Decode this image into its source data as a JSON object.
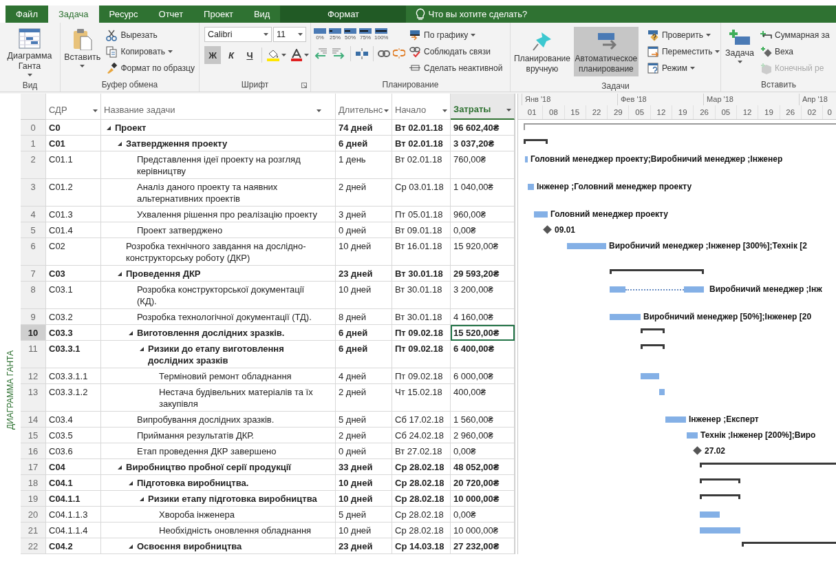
{
  "tabs": [
    {
      "label": "Файл",
      "selected": false
    },
    {
      "label": "Задача",
      "selected": true
    },
    {
      "label": "Ресурс",
      "selected": false
    },
    {
      "label": "Отчет",
      "selected": false
    },
    {
      "label": "Проект",
      "selected": false
    },
    {
      "label": "Вид",
      "selected": false
    }
  ],
  "context_tab": {
    "label": "Формат",
    "selected": false
  },
  "tell_me": {
    "placeholder": "Что вы хотите сделать?"
  },
  "ribbon": {
    "view": {
      "label": "Вид",
      "gantt_button": {
        "label": "Диаграмма Ганта",
        "dropdown": true
      }
    },
    "clipboard": {
      "label": "Буфер обмена",
      "paste": {
        "label": "Вставить",
        "dropdown": true
      },
      "items": [
        {
          "label": "Вырезать",
          "dropdown": false
        },
        {
          "label": "Копировать",
          "dropdown": true
        },
        {
          "label": "Формат по образцу",
          "dropdown": false
        }
      ]
    },
    "font": {
      "label": "Шрифт",
      "font_name": "Calibri",
      "font_size": "11",
      "styles": [
        {
          "label": "Ж",
          "on": true
        },
        {
          "label": "К",
          "on": false
        },
        {
          "label": "Ч",
          "on": false
        }
      ]
    },
    "schedule": {
      "label": "Планирование",
      "percent": [
        "0%",
        "25%",
        "50%",
        "75%",
        "100%"
      ],
      "items": [
        {
          "label": "По графику",
          "dropdown": true
        },
        {
          "label": "Соблюдать связи",
          "dropdown": false
        },
        {
          "label": "Сделать неактивной",
          "dropdown": false
        }
      ]
    },
    "tasks": {
      "label": "Задачи",
      "modes": [
        {
          "label": "Планирование вручную",
          "selected": false
        },
        {
          "label": "Автоматическое планирование",
          "selected": true
        }
      ],
      "items": [
        {
          "label": "Проверить",
          "dropdown": true
        },
        {
          "label": "Переместить",
          "dropdown": true
        },
        {
          "label": "Режим",
          "dropdown": true
        }
      ]
    },
    "insert": {
      "label": "Вставить",
      "task": {
        "label": "Задача",
        "dropdown": true
      },
      "items": [
        {
          "label": "Суммарная за",
          "disabled": false
        },
        {
          "label": "Веха",
          "disabled": false
        },
        {
          "label": "Конечный ре",
          "disabled": true
        }
      ]
    }
  },
  "view_label": "ДИАГРАММА ГАНТА",
  "columns": [
    {
      "label": "СДР",
      "selected": false
    },
    {
      "label": "Название задачи",
      "selected": false
    },
    {
      "label": "Длительнс",
      "selected": false
    },
    {
      "label": "Начало",
      "selected": false
    },
    {
      "label": "Затраты",
      "selected": true
    }
  ],
  "timeline": {
    "months": [
      "Янв '18",
      "Фев '18",
      "Мар '18",
      "Апр '18"
    ],
    "weeks": [
      "01",
      "08",
      "15",
      "22",
      "29",
      "05",
      "12",
      "19",
      "26",
      "05",
      "12",
      "19",
      "26",
      "02",
      "0"
    ]
  },
  "tasks": [
    {
      "id": "0",
      "wbs": "C0",
      "name": "Проект",
      "duration": "74 дней",
      "start": "Вт 02.01.18",
      "cost": "96 602,40₴",
      "kind": "project",
      "expanded": true,
      "selected": false,
      "children": [
        {
          "id": "1",
          "wbs": "C01",
          "name": "Затвердження проекту",
          "duration": "6 дней",
          "start": "Вт 02.01.18",
          "cost": "3 037,20₴",
          "kind": "summary",
          "expanded": true,
          "selected": false,
          "children": [
            {
              "id": "2",
              "wbs": "C01.1",
              "name": "Представлення ідеї проекту на розгляд керівництву",
              "duration": "1 день",
              "start": "Вт 02.01.18",
              "cost": "760,00₴",
              "kind": "task",
              "selected": false,
              "bar_label": "Головний менеджер проекту;Виробничий менеджер ;Інженер"
            },
            {
              "id": "3",
              "wbs": "C01.2",
              "name": "Аналіз даного проекту та наявних альтернативних проектів",
              "duration": "2 дней",
              "start": "Ср 03.01.18",
              "cost": "1 040,00₴",
              "kind": "task",
              "selected": false,
              "bar_label": "Інженер ;Головний менеджер проекту"
            },
            {
              "id": "4",
              "wbs": "C01.3",
              "name": "Ухвалення рішення про реалізацію проекту",
              "duration": "3 дней",
              "start": "Пт 05.01.18",
              "cost": "960,00₴",
              "kind": "task",
              "selected": false,
              "bar_label": "Головний менеджер проекту"
            },
            {
              "id": "5",
              "wbs": "C01.4",
              "name": "Проект затверджено",
              "duration": "0 дней",
              "start": "Вт 09.01.18",
              "cost": "0,00₴",
              "kind": "milestone",
              "selected": false,
              "bar_label": "09.01"
            }
          ]
        },
        {
          "id": "6",
          "wbs": "C02",
          "name": "Розробка технічного завдання на дослідно-конструкторську роботу (ДКР)",
          "duration": "10 дней",
          "start": "Вт 16.01.18",
          "cost": "15 920,00₴",
          "kind": "task",
          "selected": false,
          "bar_label": "Виробничий менеджер ;Інженер [300%];Технік [2"
        },
        {
          "id": "7",
          "wbs": "C03",
          "name": "Проведення ДКР",
          "duration": "23 дней",
          "start": "Вт 30.01.18",
          "cost": "29 593,20₴",
          "kind": "summary",
          "expanded": true,
          "selected": false,
          "children": [
            {
              "id": "8",
              "wbs": "C03.1",
              "name": "Розробка конструкторської документації (КД).",
              "duration": "10 дней",
              "start": "Вт 30.01.18",
              "cost": "3 200,00₴",
              "kind": "split",
              "selected": false,
              "bar_label": "Виробничий менеджер ;Інж"
            },
            {
              "id": "9",
              "wbs": "C03.2",
              "name": "Розробка технологічної документації (ТД).",
              "duration": "8 дней",
              "start": "Вт 30.01.18",
              "cost": "4 160,00₴",
              "kind": "task",
              "selected": false,
              "bar_label": "Виробничий менеджер [50%];Інженер [20"
            },
            {
              "id": "10",
              "wbs": "C03.3",
              "name": "Виготовлення дослідних зразків.",
              "duration": "6 дней",
              "start": "Пт 09.02.18",
              "cost": "15 520,00₴",
              "kind": "summary",
              "expanded": true,
              "selected": true,
              "children": [
                {
                  "id": "11",
                  "wbs": "C03.3.1",
                  "name": "Ризики до етапу виготовлення дослідних зразків",
                  "duration": "6 дней",
                  "start": "Пт 09.02.18",
                  "cost": "6 400,00₴",
                  "kind": "summary",
                  "expanded": true,
                  "selected": false,
                  "children": [
                    {
                      "id": "12",
                      "wbs": "C03.3.1.1",
                      "name": "Терміновий ремонт обладнання",
                      "duration": "4 дней",
                      "start": "Пт 09.02.18",
                      "cost": "6 000,00₴",
                      "kind": "task",
                      "selected": false
                    },
                    {
                      "id": "13",
                      "wbs": "C03.3.1.2",
                      "name": "Нестача будівельних матеріалів та їх закупівля",
                      "duration": "2 дней",
                      "start": "Чт 15.02.18",
                      "cost": "400,00₴",
                      "kind": "task",
                      "selected": false
                    }
                  ]
                }
              ]
            },
            {
              "id": "14",
              "wbs": "C03.4",
              "name": "Випробування дослідних зразків.",
              "duration": "5 дней",
              "start": "Сб 17.02.18",
              "cost": "1 560,00₴",
              "kind": "task",
              "selected": false,
              "bar_label": "Інженер ;Експерт"
            },
            {
              "id": "15",
              "wbs": "C03.5",
              "name": "Приймання результатів ДКР.",
              "duration": "2 дней",
              "start": "Сб 24.02.18",
              "cost": "2 960,00₴",
              "kind": "task",
              "selected": false,
              "bar_label": "Технік ;Інженер [200%];Виро"
            },
            {
              "id": "16",
              "wbs": "C03.6",
              "name": "Етап проведення ДКР завершено",
              "duration": "0 дней",
              "start": "Вт 27.02.18",
              "cost": "0,00₴",
              "kind": "milestone",
              "selected": false,
              "bar_label": "27.02"
            }
          ]
        },
        {
          "id": "17",
          "wbs": "C04",
          "name": "Виробництво пробної серії продукції",
          "duration": "33 дней",
          "start": "Ср 28.02.18",
          "cost": "48 052,00₴",
          "kind": "summary",
          "expanded": true,
          "selected": false,
          "children": [
            {
              "id": "18",
              "wbs": "C04.1",
              "name": "Підготовка виробництва.",
              "duration": "10 дней",
              "start": "Ср 28.02.18",
              "cost": "20 720,00₴",
              "kind": "summary",
              "expanded": true,
              "selected": false,
              "children": [
                {
                  "id": "19",
                  "wbs": "C04.1.1",
                  "name": "Ризики етапу підготовка виробництва",
                  "duration": "10 дней",
                  "start": "Ср 28.02.18",
                  "cost": "10 000,00₴",
                  "kind": "summary",
                  "expanded": true,
                  "selected": false,
                  "children": [
                    {
                      "id": "20",
                      "wbs": "C04.1.1.3",
                      "name": "Хвороба інженера",
                      "duration": "5 дней",
                      "start": "Ср 28.02.18",
                      "cost": "0,00₴",
                      "kind": "task",
                      "selected": false
                    },
                    {
                      "id": "21",
                      "wbs": "C04.1.1.4",
                      "name": "Необхідність оновлення обладнання",
                      "duration": "10 дней",
                      "start": "Ср 28.02.18",
                      "cost": "10 000,00₴",
                      "kind": "task",
                      "selected": false
                    }
                  ]
                }
              ]
            },
            {
              "id": "22",
              "wbs": "C04.2",
              "name": "Освоєння виробництва",
              "duration": "23 дней",
              "start": "Ср 14.03.18",
              "cost": "27 232,00₴",
              "kind": "summary",
              "expanded": true,
              "selected": false
            }
          ]
        }
      ]
    }
  ]
}
